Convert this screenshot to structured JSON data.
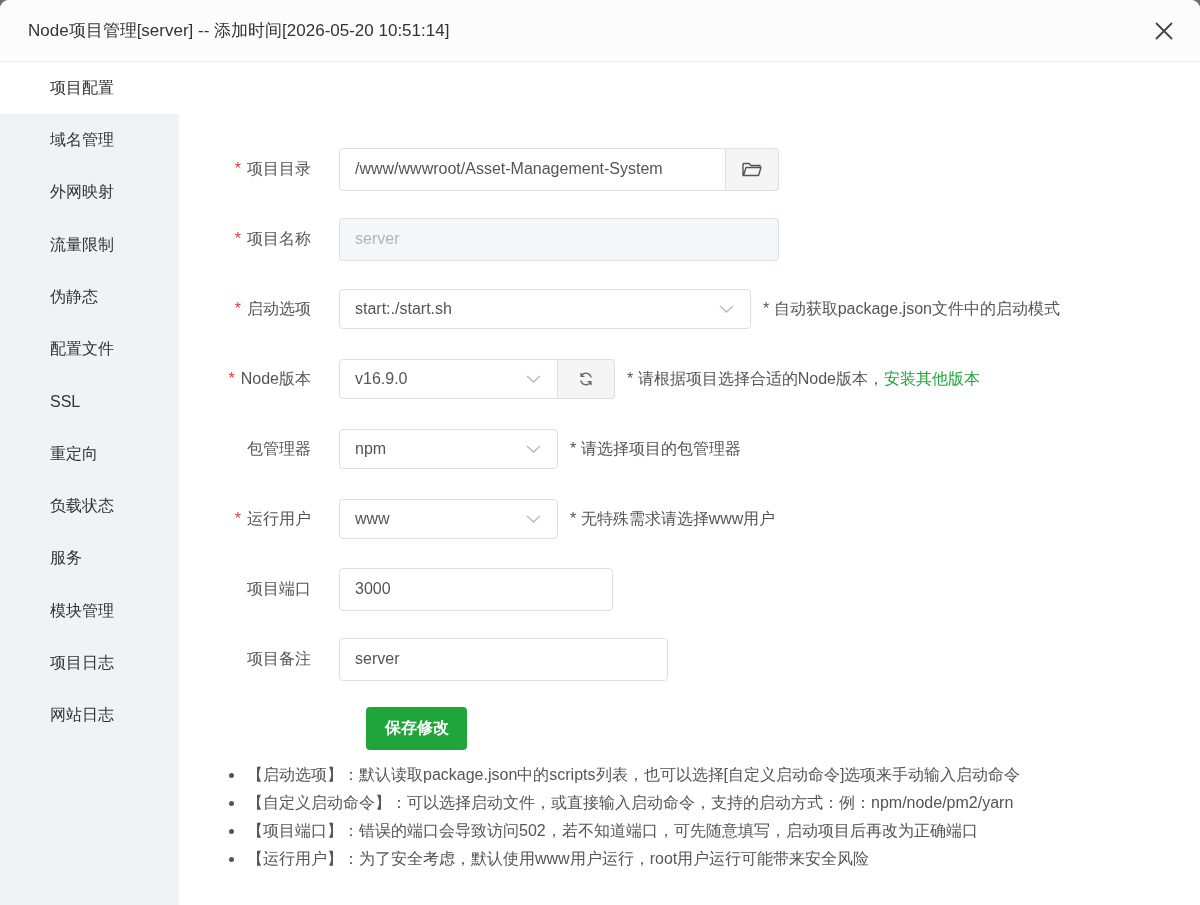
{
  "dialog": {
    "title": "Node项目管理[server] -- 添加时间[2026-05-20 10:51:14]"
  },
  "sidebar": {
    "items": [
      {
        "label": "项目配置",
        "selected": true
      },
      {
        "label": "域名管理",
        "selected": false
      },
      {
        "label": "外网映射",
        "selected": false
      },
      {
        "label": "流量限制",
        "selected": false
      },
      {
        "label": "伪静态",
        "selected": false
      },
      {
        "label": "配置文件",
        "selected": false
      },
      {
        "label": "SSL",
        "selected": false
      },
      {
        "label": "重定向",
        "selected": false
      },
      {
        "label": "负载状态",
        "selected": false
      },
      {
        "label": "服务",
        "selected": false
      },
      {
        "label": "模块管理",
        "selected": false
      },
      {
        "label": "项目日志",
        "selected": false
      },
      {
        "label": "网站日志",
        "selected": false
      }
    ]
  },
  "form": {
    "fields": [
      {
        "kind": "path",
        "required_mark": "*",
        "label": "项目目录",
        "value": "/www/wwwroot/Asset-Management-System",
        "disabled": false
      },
      {
        "kind": "text",
        "required_mark": "*",
        "label": "项目名称",
        "value": "server",
        "disabled": true
      },
      {
        "kind": "select",
        "required_mark": "*",
        "label": "启动选项",
        "value": "start:./start.sh",
        "disabled": false,
        "hint": "* 自动获取package.json文件中的启动模式"
      },
      {
        "kind": "select-refresh",
        "required_mark": "*",
        "label": "Node版本",
        "value": "v16.9.0",
        "disabled": false,
        "hint": "* 请根据项目选择合适的Node版本，",
        "link": "安装其他版本"
      },
      {
        "kind": "select",
        "label": "包管理器",
        "value": "npm",
        "disabled": false,
        "hint": "* 请选择项目的包管理器"
      },
      {
        "kind": "select",
        "required_mark": "*",
        "label": "运行用户",
        "value": "www",
        "disabled": false,
        "hint": "* 无特殊需求请选择www用户"
      },
      {
        "kind": "text",
        "label": "项目端口",
        "value": "3000",
        "disabled": false
      },
      {
        "kind": "text",
        "label": "项目备注",
        "value": "server",
        "disabled": false
      }
    ],
    "save_button": "保存修改"
  },
  "notes": [
    "【启动选项】：默认读取package.json中的scripts列表，也可以选择[自定义启动命令]选项来手动输入启动命令",
    "【自定义启动命令】：可以选择启动文件，或直接输入启动命令，支持的启动方式：例：npm/node/pm2/yarn",
    "【项目端口】：错误的端口会导致访问502，若不知道端口，可先随意填写，启动项目后再改为正确端口",
    "【运行用户】：为了安全考虑，默认使用www用户运行，root用户运行可能带来安全风险"
  ]
}
